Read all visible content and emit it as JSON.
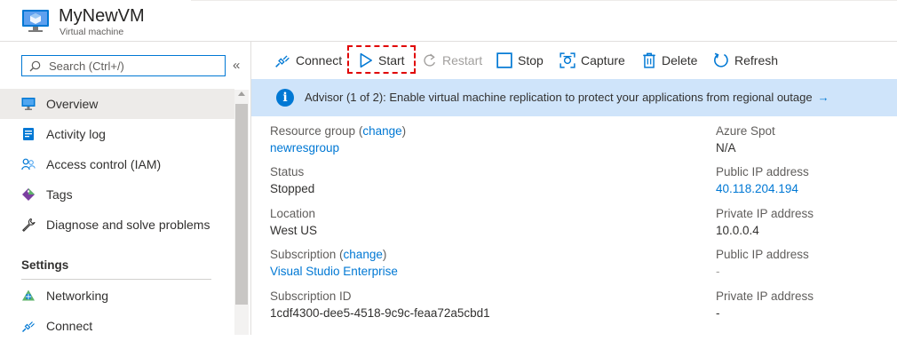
{
  "header": {
    "title": "MyNewVM",
    "subtitle": "Virtual machine",
    "icon": "virtual-machine-icon"
  },
  "sidebar": {
    "search_placeholder": "Search (Ctrl+/)",
    "collapse_glyph": "«",
    "items": [
      {
        "label": "Overview",
        "icon": "overview-monitor-icon",
        "active": true
      },
      {
        "label": "Activity log",
        "icon": "activity-log-icon"
      },
      {
        "label": "Access control (IAM)",
        "icon": "access-control-people-icon"
      },
      {
        "label": "Tags",
        "icon": "tag-icon"
      },
      {
        "label": "Diagnose and solve problems",
        "icon": "wrench-icon"
      }
    ],
    "section_heading": "Settings",
    "settings_items": [
      {
        "label": "Networking",
        "icon": "networking-icon"
      },
      {
        "label": "Connect",
        "icon": "connect-plug-icon"
      }
    ]
  },
  "toolbar": {
    "connect": "Connect",
    "start": "Start",
    "restart": "Restart",
    "stop": "Stop",
    "capture": "Capture",
    "delete": "Delete",
    "refresh": "Refresh",
    "highlight_color": "#e00000"
  },
  "advisor": {
    "text": "Advisor (1 of 2): Enable virtual machine replication to protect your applications from regional outage",
    "arrow": "→",
    "background": "#cfe4fa"
  },
  "properties": {
    "resource_group_label": "Resource group",
    "change_link": "change",
    "resource_group_value": "newresgroup",
    "status_label": "Status",
    "status_value": "Stopped",
    "location_label": "Location",
    "location_value": "West US",
    "subscription_label": "Subscription",
    "subscription_value": "Visual Studio Enterprise",
    "subscription_id_label": "Subscription ID",
    "subscription_id_value": "1cdf4300-dee5-4518-9c9c-feaa72a5cbd1",
    "azure_spot_label": "Azure Spot",
    "azure_spot_value": "N/A",
    "public_ip_label": "Public IP address",
    "public_ip_value": "40.118.204.194",
    "private_ip_label": "Private IP address",
    "private_ip_value": "10.0.0.4",
    "public_ip2_label": "Public IP address",
    "public_ip2_value": "-",
    "private_ip2_label": "Private IP address",
    "private_ip2_value": "-"
  },
  "colors": {
    "accent": "#0078d4",
    "sidebar_active": "#edebe9"
  }
}
